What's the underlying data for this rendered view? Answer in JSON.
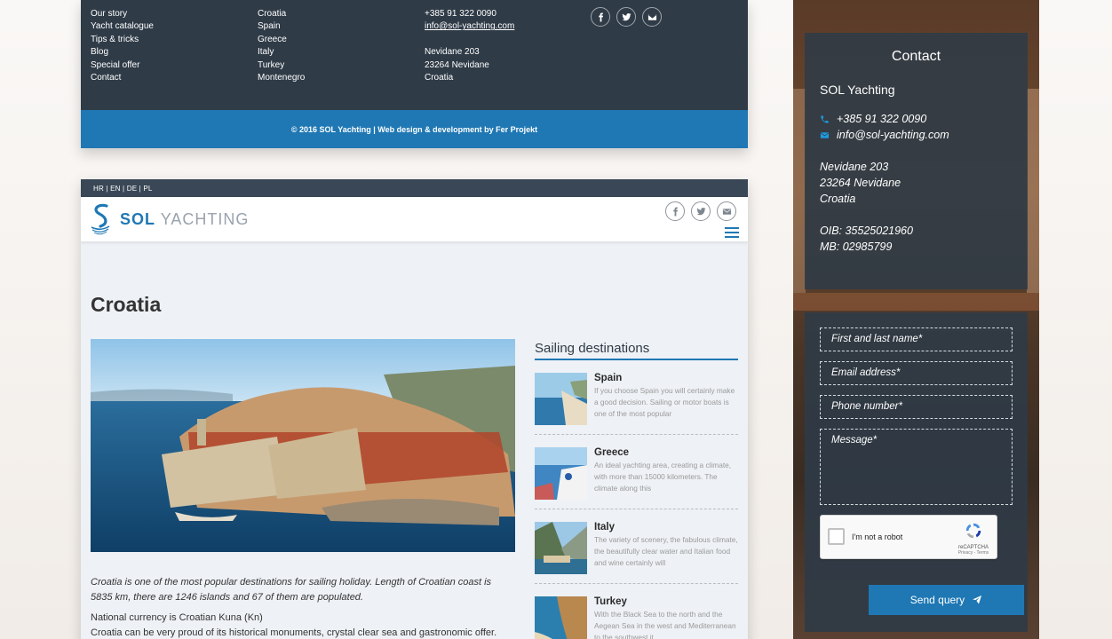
{
  "footer": {
    "links": [
      "Our story",
      "Yacht catalogue",
      "Tips & tricks",
      "Blog",
      "Special offer",
      "Contact"
    ],
    "destinations": [
      "Croatia",
      "Spain",
      "Greece",
      "Italy",
      "Turkey",
      "Montenegro"
    ],
    "phone": "+385 91 322 0090",
    "email": "info@sol-yachting.com",
    "address": [
      "Nevidane 203",
      "23264 Nevidane",
      "Croatia"
    ],
    "copyright": "© 2016 SOL Yachting | Web design & development by Fer Projekt"
  },
  "site": {
    "languages": "HR | EN | DE | PL",
    "logo_bold": "SOL",
    "logo_light": "YACHTING",
    "page_title": "Croatia",
    "intro_italic": "Croatia is one of the most popular destinations for sailing holiday. Length of Croatian coast is 5835 km, there are 1246 islands and 67 of them are populated.",
    "intro_1": "National currency is Croatian Kuna (Kn)",
    "intro_2": "Croatia can be very proud of its historical monuments, crystal clear sea and gastronomic offer."
  },
  "sidebar": {
    "title": "Sailing destinations",
    "items": [
      {
        "name": "Spain",
        "text": "If you choose Spain you will certainly make a good decision. Sailing or motor boats is one of the most popular"
      },
      {
        "name": "Greece",
        "text": "An ideal yachting area, creating a climate, with more than 15000 kilometers. The climate along this"
      },
      {
        "name": "Italy",
        "text": "The variety of scenery, the fabulous climate, the beautifully clear water and Italian food and wine certainly will"
      },
      {
        "name": "Turkey",
        "text": "With the Black Sea to the north and the Aegean Sea in the west and Mediterranean to the southwest it"
      }
    ]
  },
  "contact": {
    "title": "Contact",
    "company": "SOL Yachting",
    "phone": "+385 91 322 0090",
    "email": "info@sol-yachting.com",
    "address": [
      "Nevidane 203",
      "23264 Nevidane",
      "Croatia"
    ],
    "oib": "OIB: 35525021960",
    "mb": "MB: 02985799"
  },
  "form": {
    "name_placeholder": "First and last name*",
    "email_placeholder": "Email address*",
    "phone_placeholder": "Phone number*",
    "message_placeholder": "Message*",
    "captcha_label": "I'm not a robot",
    "captcha_brand": "reCAPTCHA",
    "captcha_links": "Privacy - Terms",
    "send_label": "Send query"
  },
  "colors": {
    "dark": "#2f3b47",
    "accent": "#1f78b4"
  }
}
